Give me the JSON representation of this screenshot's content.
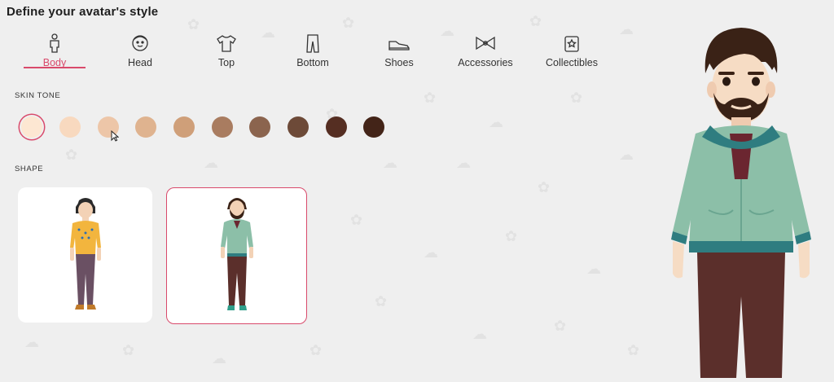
{
  "page": {
    "title": "Define your avatar's style"
  },
  "tabs": [
    {
      "label": "Body",
      "icon": "body-icon",
      "active": true
    },
    {
      "label": "Head",
      "icon": "head-icon"
    },
    {
      "label": "Top",
      "icon": "tshirt-icon"
    },
    {
      "label": "Bottom",
      "icon": "pants-icon"
    },
    {
      "label": "Shoes",
      "icon": "shoe-icon"
    },
    {
      "label": "Accessories",
      "icon": "bow-icon"
    },
    {
      "label": "Collectibles",
      "icon": "collectibles-icon"
    }
  ],
  "skin_tone": {
    "label": "SKIN TONE",
    "colors": [
      "#fde7d2",
      "#f8d9bf",
      "#edc6a8",
      "#dfb38f",
      "#cf9f79",
      "#a97c60",
      "#8b644e",
      "#6d4a38",
      "#552e22",
      "#432418"
    ],
    "selected_index": 0
  },
  "shape": {
    "label": "SHAPE",
    "options": [
      {
        "name": "female-avatar",
        "selected": false
      },
      {
        "name": "male-avatar",
        "selected": true
      }
    ]
  },
  "colors": {
    "accent": "#d94a6b",
    "jacket": "#8cbfa8",
    "jacket_trim": "#2f7d80",
    "pants": "#5b2f2b",
    "hair": "#3a2216"
  }
}
